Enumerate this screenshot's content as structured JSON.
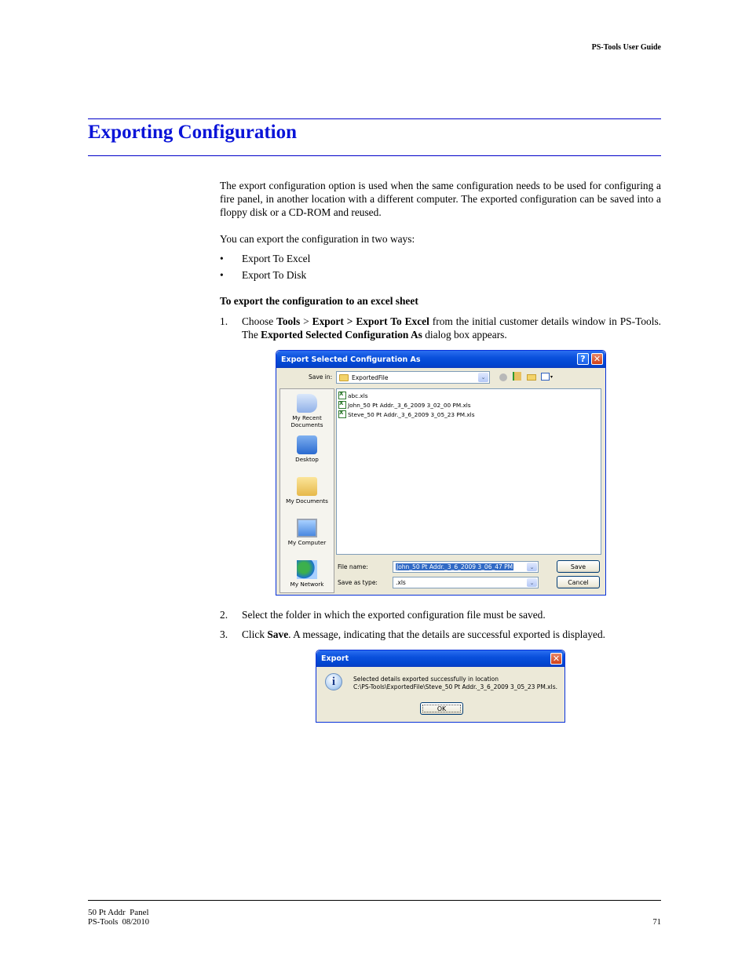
{
  "header": {
    "running_title": "PS-Tools User Guide"
  },
  "section": {
    "title": "Exporting Configuration",
    "accent_color": "#0a14d8"
  },
  "intro": {
    "paragraph": "The export configuration option is used when the same configuration needs to be used for configuring a fire panel, in another location with a different computer. The exported configuration can be saved into a floppy disk or a CD-ROM and reused.",
    "ways_lead": "You can export the configuration in two ways:",
    "bullets": [
      {
        "mark": "•",
        "text": "Export To Excel"
      },
      {
        "mark": "•",
        "text": "Export To Disk"
      }
    ]
  },
  "procedure": {
    "heading": "To export the configuration to an excel sheet",
    "step1": {
      "num": "1.",
      "p1": "Choose ",
      "b1": "Tools",
      "p2": " > ",
      "b2": "Export > Export To Excel",
      "p3": " from the initial customer details window in PS-Tools. The ",
      "b3": "Exported Selected Configuration As",
      "p4": " dialog box appears."
    },
    "step2": {
      "num": "2.",
      "text": "Select the folder in which the exported configuration file must be saved."
    },
    "step3": {
      "num": "3.",
      "p1": "Click ",
      "b1": "Save",
      "p2": ". A message, indicating that the details are successful exported is displayed."
    }
  },
  "save_dialog": {
    "title": "Export Selected Configuration As",
    "help_glyph": "?",
    "close_glyph": "✕",
    "save_in_label": "Save in:",
    "save_in_value": "ExportedFile",
    "dropdown_glyph": "⌄",
    "places": [
      {
        "label": "My Recent Documents"
      },
      {
        "label": "Desktop"
      },
      {
        "label": "My Documents"
      },
      {
        "label": "My Computer"
      },
      {
        "label": "My Network"
      }
    ],
    "files": [
      {
        "name": "abc.xls"
      },
      {
        "name": "John_50 Pt Addr._3_6_2009 3_02_00 PM.xls"
      },
      {
        "name": "Steve_50 Pt Addr._3_6_2009 3_05_23 PM.xls"
      }
    ],
    "file_name_label": "File name:",
    "file_name_value": "John_50 Pt Addr._3_6_2009 3_06_47 PM",
    "save_as_type_label": "Save as type:",
    "save_as_type_value": ".xls",
    "save_button": "Save",
    "cancel_button": "Cancel"
  },
  "export_dialog": {
    "title": "Export",
    "close_glyph": "✕",
    "info_glyph": "i",
    "message_line1": "Selected details exported successfully in location",
    "message_line2": "C:\\PS-Tools\\ExportedFile\\Steve_50 Pt Addr._3_6_2009 3_05_23 PM.xls.",
    "ok_button": "OK"
  },
  "footer": {
    "line1": "50 Pt Addr  Panel",
    "line2": "PS-Tools  08/2010",
    "page_number": "71"
  }
}
